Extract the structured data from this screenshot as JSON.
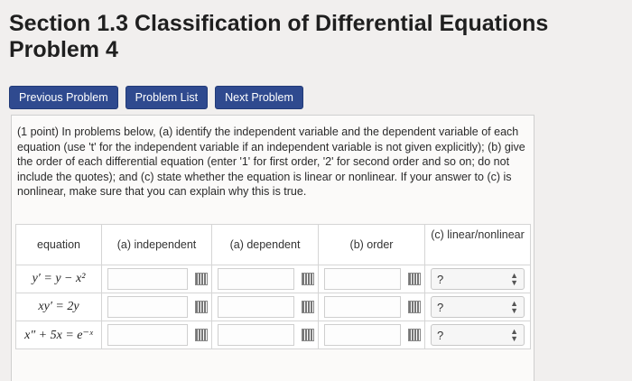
{
  "header": {
    "title_line1": "Section 1.3 Classification of Differential Equations",
    "title_line2": "Problem 4"
  },
  "nav": {
    "previous": "Previous Problem",
    "list": "Problem List",
    "next": "Next Problem"
  },
  "problem": {
    "instructions": "(1 point) In problems below, (a) identify the independent variable and the dependent variable of each equation (use 't' for the independent variable if an independent variable is not given explicitly); (b) give the order of each differential equation (enter '1' for first order, '2' for second order and so on; do not include the quotes); and (c) state whether the equation is linear or nonlinear. If your answer to (c) is nonlinear, make sure that you can explain why this is true."
  },
  "table": {
    "headers": {
      "equation": "equation",
      "independent": "(a) independent",
      "dependent": "(a) dependent",
      "order": "(b) order",
      "linear": "(c) linear/nonlinear"
    },
    "rows": [
      {
        "equation": "y′ = y − x²",
        "independent": "",
        "dependent": "",
        "order": "",
        "linear": "?"
      },
      {
        "equation": "xy′ = 2y",
        "independent": "",
        "dependent": "",
        "order": "",
        "linear": "?"
      },
      {
        "equation": "x″ + 5x = e⁻ˣ",
        "independent": "",
        "dependent": "",
        "order": "",
        "linear": "?"
      }
    ]
  },
  "icons": {
    "matrix": "matrix-input-icon",
    "select_arrows": "updown-arrows-icon"
  }
}
